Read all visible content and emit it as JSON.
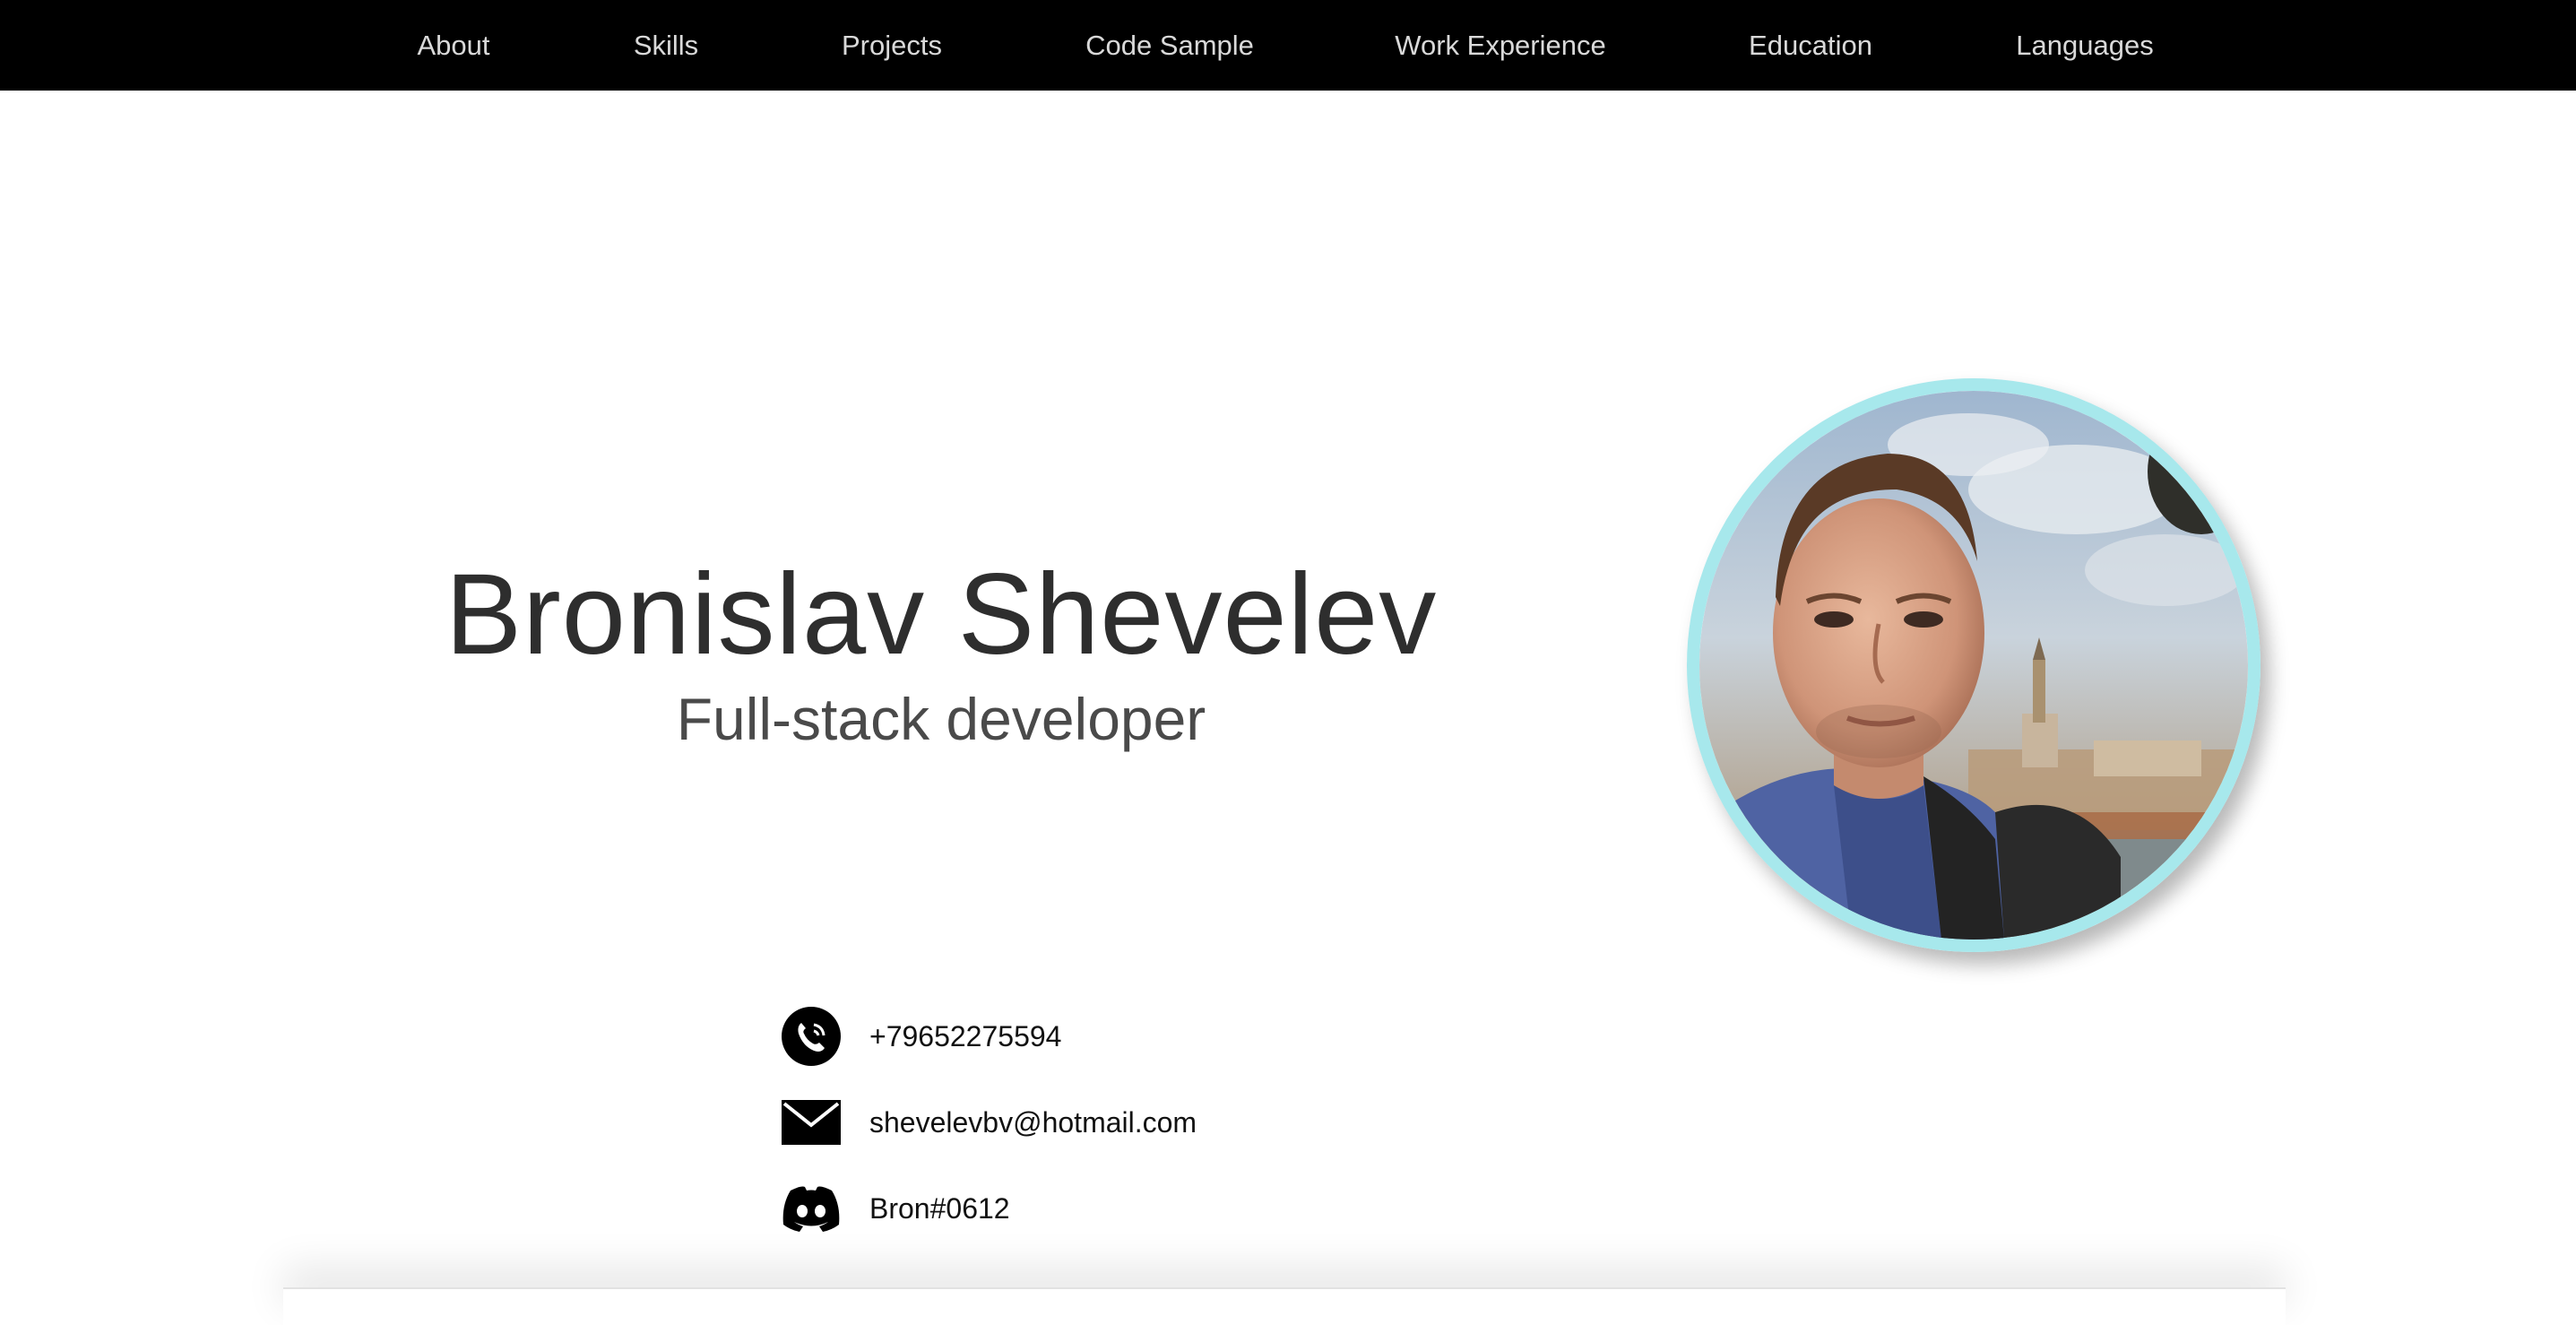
{
  "nav": {
    "items": [
      {
        "label": "About"
      },
      {
        "label": "Skills"
      },
      {
        "label": "Projects"
      },
      {
        "label": "Code Sample"
      },
      {
        "label": "Work Experience"
      },
      {
        "label": "Education"
      },
      {
        "label": "Languages"
      }
    ]
  },
  "hero": {
    "name": "Bronislav Shevelev",
    "role": "Full-stack developer"
  },
  "avatar": {
    "ring_color": "#a7e8ec"
  },
  "contacts": {
    "phone": {
      "icon": "phone-icon",
      "value": "+79652275594"
    },
    "email": {
      "icon": "mail-icon",
      "value": "shevelevbv@hotmail.com"
    },
    "discord": {
      "icon": "discord-icon",
      "value": "Bron#0612"
    }
  },
  "colors": {
    "nav_bg": "#000000",
    "nav_text": "#d9d9d9",
    "name_text": "#2e2e2e",
    "role_text": "#4a4a4a"
  }
}
